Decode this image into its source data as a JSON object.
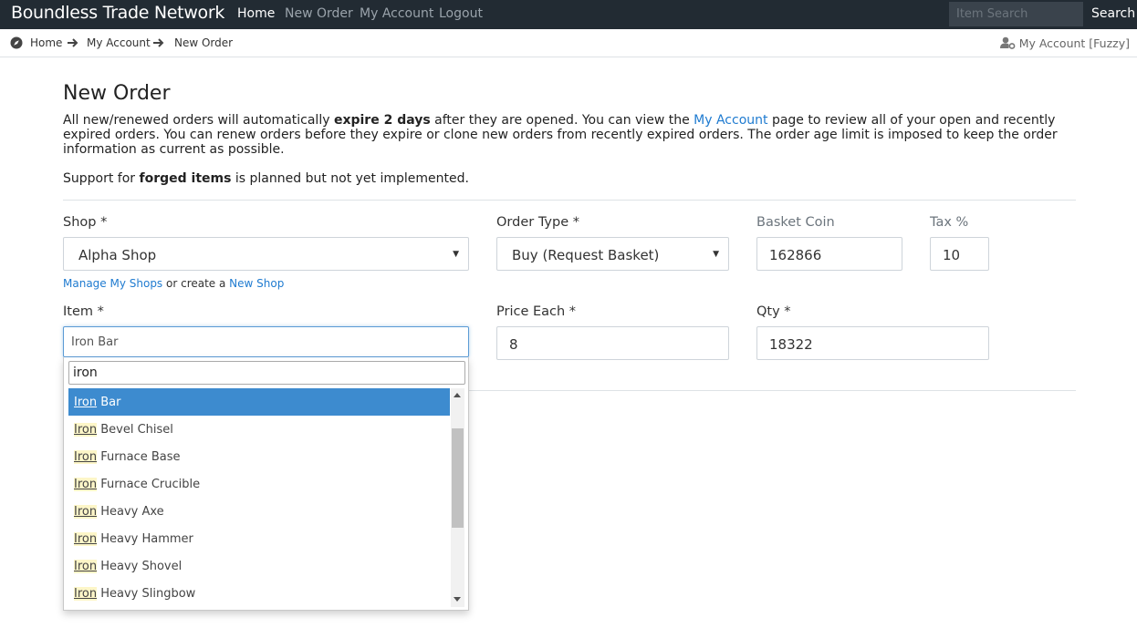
{
  "navbar": {
    "brand": "Boundless Trade Network",
    "links": [
      "Home",
      "New Order",
      "My Account",
      "Logout"
    ],
    "search_placeholder": "Item Search",
    "search_button": "Search"
  },
  "breadcrumb": {
    "items": [
      "Home",
      "My Account",
      "New Order"
    ],
    "account_link": "My Account [Fuzzy]"
  },
  "page": {
    "title": "New Order",
    "intro_1": "All new/renewed orders will automatically ",
    "intro_bold": "expire 2 days",
    "intro_2": " after they are opened. You can view the ",
    "intro_link": "My Account",
    "intro_3": " page to review all of your open and recently expired orders. You can renew orders before they expire or clone new orders from recently expired orders. The order age limit is imposed to keep the order information as current as possible.",
    "support_1": "Support for ",
    "support_bold": "forged items",
    "support_2": " is planned but not yet implemented."
  },
  "form": {
    "shop_label": "Shop *",
    "shop_value": "Alpha Shop",
    "order_type_label": "Order Type *",
    "order_type_value": "Buy (Request Basket)",
    "basket_coin_label": "Basket Coin",
    "basket_coin_value": "162866",
    "tax_label": "Tax %",
    "tax_value": "10",
    "manage_shops": "Manage My Shops",
    "or_create": " or create a ",
    "new_shop": "New Shop",
    "item_label": "Item *",
    "item_value": "Iron Bar",
    "price_label": "Price Each *",
    "price_value": "8",
    "qty_label": "Qty *",
    "qty_value": "18322"
  },
  "dropdown": {
    "search_value": "iron",
    "match": "Iron",
    "options": [
      " Bar",
      " Bevel Chisel",
      " Furnace Base",
      " Furnace Crucible",
      " Heavy Axe",
      " Heavy Hammer",
      " Heavy Shovel",
      " Heavy Slingbow"
    ]
  },
  "colors": {
    "navbar": "#222b33",
    "link": "#1f7bd0",
    "highlight": "#3d8bcf"
  }
}
